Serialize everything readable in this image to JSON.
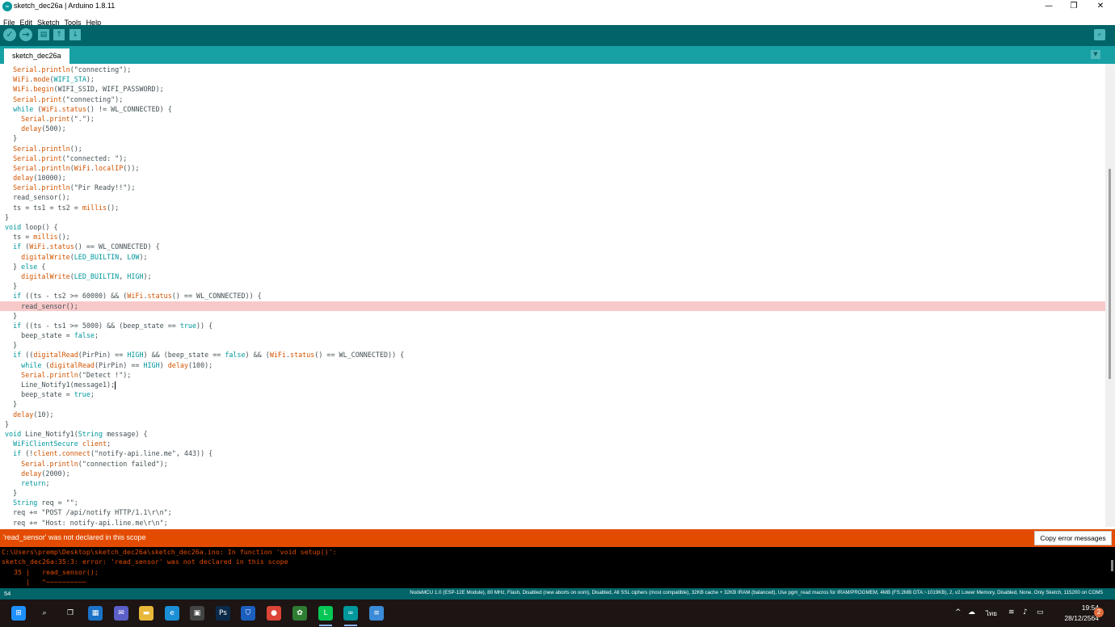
{
  "window": {
    "title": "sketch_dec26a | Arduino 1.8.11",
    "icon": "arduino-icon",
    "minimize": "—",
    "restore": "❐",
    "close": "✕"
  },
  "menu": [
    "File",
    "Edit",
    "Sketch",
    "Tools",
    "Help"
  ],
  "toolbar": {
    "verify": "✓",
    "upload": "→",
    "new": "▤",
    "open": "↑",
    "save": "↓",
    "serial_monitor": "⌕"
  },
  "tab": {
    "label": "sketch_dec26a",
    "menu": "▼"
  },
  "editor": {
    "lines": [
      "  Serial.println(\"connecting\");",
      "  WiFi.mode(WIFI_STA);",
      "  WiFi.begin(WIFI_SSID, WIFI_PASSWORD);",
      "  Serial.print(\"connecting\");",
      "  while (WiFi.status() != WL_CONNECTED) {",
      "    Serial.print(\".\");",
      "    delay(500);",
      "  }",
      "  Serial.println();",
      "  Serial.print(\"connected: \");",
      "  Serial.println(WiFi.localIP());",
      "  delay(10000);",
      "  Serial.println(\"Pir Ready!!\");",
      "  read_sensor();",
      "  ts = ts1 = ts2 = millis();",
      "}",
      "void loop() {",
      "  ts = millis();",
      "  if (WiFi.status() == WL_CONNECTED) {",
      "    digitalWrite(LED_BUILTIN, LOW);",
      "  } else {",
      "    digitalWrite(LED_BUILTIN, HIGH);",
      "  }",
      "  if ((ts - ts2 >= 60000) && (WiFi.status() == WL_CONNECTED)) {",
      "    read_sensor();",
      "  }",
      "  if ((ts - ts1 >= 5000) && (beep_state == true)) {",
      "    beep_state = false;",
      "  }",
      "  if ((digitalRead(PirPin) == HIGH) && (beep_state == false) && (WiFi.status() == WL_CONNECTED)) {",
      "    while (digitalRead(PirPin) == HIGH) delay(100);",
      "    Serial.println(\"Detect !\");",
      "    Line_Notify1(message1);",
      "    beep_state = true;",
      "  }",
      "  delay(10);",
      "}",
      "void Line_Notify1(String message) {",
      "  WiFiClientSecure client;",
      "  if (!client.connect(\"notify-api.line.me\", 443)) {",
      "    Serial.println(\"connection failed\");",
      "    delay(2000);",
      "    return;",
      "  }",
      "  String req = \"\";",
      "  req += \"POST /api/notify HTTP/1.1\\r\\n\";",
      "  req += \"Host: notify-api.line.me\\r\\n\";"
    ],
    "highlighted_line_index": 24,
    "caret_line_index": 32
  },
  "error": {
    "message": "'read_sensor' was not declared in this scope",
    "copy_button": "Copy error messages"
  },
  "console": {
    "lines": [
      "C:\\Users\\premp\\Desktop\\sketch_dec26a\\sketch_dec26a.ino: In function 'void setup()':",
      "sketch_dec26a:35:3: error: 'read_sensor' was not declared in this scope",
      "   35 |   read_sensor();",
      "      |   ^~~~~~~~~~~"
    ]
  },
  "status": {
    "line_number": "54",
    "board": "NodeMCU 1.0 (ESP-12E Module), 80 MHz, Flash, Disabled (new aborts on oom), Disabled, All SSL ciphers (most compatible), 32KB cache + 32KB IRAM (balanced), Use pgm_read macros for IRAM/PROGMEM, 4MB (FS:2MB OTA:~1019KB), 2, v2 Lower Memory, Disabled, None, Only Sketch, 115200 on COM5"
  },
  "taskbar": {
    "apps": [
      {
        "name": "windows-start-icon",
        "glyph": "⊞",
        "color": "#1e90ff"
      },
      {
        "name": "search-icon",
        "glyph": "⌕",
        "color": "transparent"
      },
      {
        "name": "task-view-icon",
        "glyph": "❐",
        "color": "transparent"
      },
      {
        "name": "widgets-icon",
        "glyph": "▦",
        "color": "#1a73c8"
      },
      {
        "name": "teams-chat-icon",
        "glyph": "✉",
        "color": "#5b5fc7"
      },
      {
        "name": "file-explorer-icon",
        "glyph": "▬",
        "color": "#e8b83a"
      },
      {
        "name": "edge-icon",
        "glyph": "e",
        "color": "#1b8fd6"
      },
      {
        "name": "store-icon",
        "glyph": "▣",
        "color": "#444"
      },
      {
        "name": "photoshop-icon",
        "glyph": "Ps",
        "color": "#0b2a4a"
      },
      {
        "name": "shield-app-icon",
        "glyph": "⛉",
        "color": "#1b5fbf"
      },
      {
        "name": "chrome-icon",
        "glyph": "●",
        "color": "#db4437"
      },
      {
        "name": "app-green-icon",
        "glyph": "✿",
        "color": "#2e7d32"
      },
      {
        "name": "line-icon",
        "glyph": "L",
        "color": "#06c755"
      },
      {
        "name": "arduino-taskbar-icon",
        "glyph": "∞",
        "color": "#00979c"
      },
      {
        "name": "notepad-icon",
        "glyph": "≡",
        "color": "#3b8bd8"
      }
    ],
    "tray": {
      "chevron": "^",
      "cloud": "☁",
      "lang": "ไทย",
      "wifi": "≋",
      "volume": "♪",
      "battery": "▭"
    },
    "time": "19:54",
    "date": "28/12/2564",
    "notifications": "2"
  }
}
